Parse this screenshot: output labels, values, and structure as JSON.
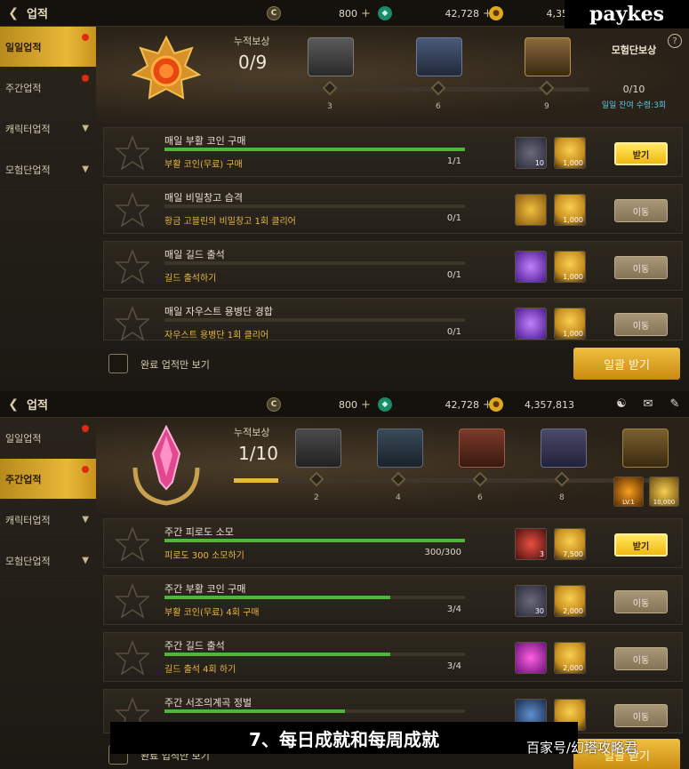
{
  "panels": [
    {
      "back_icon": "back-arrow-icon",
      "title": "업적",
      "currencies": [
        {
          "icon": "coin-c-icon",
          "value": "800"
        },
        {
          "icon": "green-gem-icon",
          "value": "42,728"
        },
        {
          "icon": "gold-coin-icon",
          "value": "4,357"
        }
      ],
      "sidebar": [
        {
          "label": "일일업적",
          "active": true,
          "dot": true
        },
        {
          "label": "주간업적",
          "active": false,
          "dot": true
        },
        {
          "label": "캐릭터업적",
          "active": false,
          "chevron": true
        },
        {
          "label": "모험단업적",
          "active": false,
          "chevron": true
        }
      ],
      "header": {
        "acc_label": "누적보상",
        "acc_count": "0/9",
        "progress": 0,
        "milestones": [
          "3",
          "6",
          "9"
        ],
        "party_title": "모험단보상",
        "party_count": "0/10",
        "party_remaining": "일일 잔여 수령:3회"
      },
      "rows": [
        {
          "name": "매일 부활 코인 구매",
          "desc": "부활 코인(무료) 구매",
          "progress": "1/1",
          "fill": 1.0,
          "r1": "10",
          "r2": "1,000",
          "button": "받기",
          "claim": true
        },
        {
          "name": "매일 비밀창고 습격",
          "desc": "황금 고블린의 비밀창고 1회 클리어",
          "progress": "0/1",
          "fill": 0,
          "r1": "",
          "r2": "1,000",
          "button": "이동",
          "claim": false
        },
        {
          "name": "매일 길드 출석",
          "desc": "길드 출석하기",
          "progress": "0/1",
          "fill": 0,
          "r1": "",
          "r2": "1,000",
          "button": "이동",
          "claim": false
        },
        {
          "name": "매일 자우스트 용병단 경합",
          "desc": "자우스트 용병단 1회 클리어",
          "progress": "0/1",
          "fill": 0,
          "r1": "",
          "r2": "1,000",
          "button": "이동",
          "claim": false
        }
      ],
      "footer_label": "완료 업적만 보기",
      "claim_all": "일괄 받기"
    },
    {
      "back_icon": "back-arrow-icon",
      "title": "업적",
      "currencies": [
        {
          "icon": "coin-c-icon",
          "value": "800"
        },
        {
          "icon": "green-gem-icon",
          "value": "42,728"
        },
        {
          "icon": "gold-coin-icon",
          "value": "4,357,813"
        }
      ],
      "sidebar": [
        {
          "label": "일일업적",
          "active": false,
          "dot": true
        },
        {
          "label": "주간업적",
          "active": true,
          "dot": true
        },
        {
          "label": "캐릭터업적",
          "active": false,
          "chevron": true
        },
        {
          "label": "모험단업적",
          "active": false,
          "chevron": true
        }
      ],
      "header": {
        "acc_label": "누적보상",
        "acc_count": "1/10",
        "progress": 0.1,
        "milestones": [
          "2",
          "4",
          "6",
          "8"
        ],
        "extra_reward_1": "LV.1",
        "extra_reward_2": "10,000"
      },
      "rows": [
        {
          "name": "주간 피로도 소모",
          "desc": "피로도 300 소모하기",
          "progress": "300/300",
          "fill": 1.0,
          "r1": "3",
          "r2": "7,500",
          "button": "받기",
          "claim": true
        },
        {
          "name": "주간 부활 코인 구매",
          "desc": "부활 코인(무료) 4회 구매",
          "progress": "3/4",
          "fill": 0.75,
          "r1": "30",
          "r2": "2,000",
          "button": "이동",
          "claim": false
        },
        {
          "name": "주간 길드 출석",
          "desc": "길드 출석 4회 하기",
          "progress": "3/4",
          "fill": 0.75,
          "r1": "",
          "r2": "2,000",
          "button": "이동",
          "claim": false
        },
        {
          "name": "주간 서조의계곡 정벌",
          "desc": "",
          "progress": "",
          "fill": 0.6,
          "r1": "",
          "r2": "",
          "button": "이동",
          "claim": false
        }
      ],
      "footer_label": "완료 업적만 보기",
      "claim_all": "일괄 받기"
    }
  ],
  "watermark_top": "paykes",
  "caption": "7、每日成就和每周成就",
  "watermark_bottom": "百家号/幻塔攻略君",
  "colors": {
    "accent": "#e8b838",
    "progress": "#4ab838",
    "alert": "#e02a10"
  }
}
